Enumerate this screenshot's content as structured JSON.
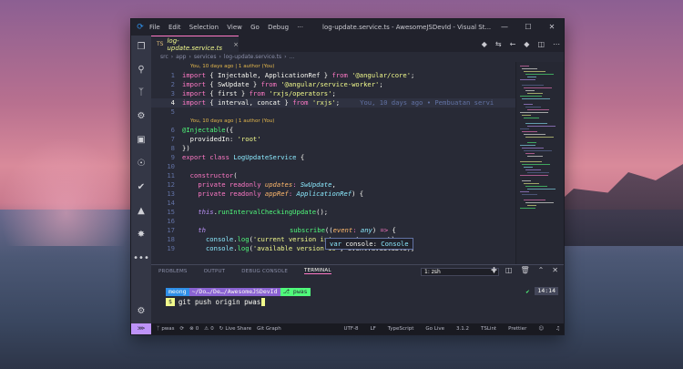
{
  "window": {
    "title": "log-update.service.ts - AwesomeJSDevId - Visual St...",
    "menu": [
      "File",
      "Edit",
      "Selection",
      "View",
      "Go",
      "Debug",
      "···"
    ],
    "controls": {
      "minimize": "—",
      "maximize": "☐",
      "close": "✕"
    }
  },
  "activity_bar": [
    "files-icon",
    "search-icon",
    "source-control-icon",
    "debug-icon",
    "extensions-icon",
    "git-lens-icon",
    "test-icon",
    "remote-icon",
    "settings-sync-icon",
    "more-icon",
    "gear-icon"
  ],
  "tab": {
    "badge": "TS",
    "label": "log-update.service.ts",
    "close": "×"
  },
  "breadcrumb": [
    "src",
    "app",
    "services",
    "log-update.service.ts",
    "..."
  ],
  "editor": {
    "blame_1": "You, 10 days ago | 1 author (You)",
    "blame_2": "You, 10 days ago | 1 author (You)",
    "inline_blame": "You, 10 days ago • Pembuatan servi",
    "line_numbers": [
      "1",
      "2",
      "3",
      "4",
      "5",
      "6",
      "7",
      "8",
      "9",
      "10",
      "11",
      "12",
      "13",
      "14",
      "15",
      "16",
      "17",
      "18",
      "19"
    ],
    "code": {
      "l1": [
        "import",
        " { ",
        "Injectable",
        ", ",
        "ApplicationRef",
        " } ",
        "from",
        " ",
        "'@angular/core'",
        ";"
      ],
      "l2": [
        "import",
        " { ",
        "SwUpdate",
        " } ",
        "from",
        " ",
        "'@angular/service-worker'",
        ";"
      ],
      "l3": [
        "import",
        " { ",
        "first",
        " } ",
        "from",
        " ",
        "'rxjs/operators'",
        ";"
      ],
      "l4": [
        "import",
        " { ",
        "interval",
        ", ",
        "concat",
        " } ",
        "from",
        " ",
        "'rxjs'",
        ";"
      ],
      "l6": [
        "@",
        "Injectable",
        "({"
      ],
      "l7": [
        "  providedIn",
        ": ",
        "'root'"
      ],
      "l8": [
        "})"
      ],
      "l9": [
        "export",
        " ",
        "class",
        " ",
        "LogUpdateService",
        " {"
      ],
      "l11": [
        "  ",
        "constructor",
        "("
      ],
      "l12": [
        "    ",
        "private",
        " ",
        "readonly",
        " ",
        "updates",
        ": ",
        "SwUpdate",
        ","
      ],
      "l13": [
        "    ",
        "private",
        " ",
        "readonly",
        " ",
        "appRef",
        ": ",
        "ApplicationRef",
        ") {"
      ],
      "l15": [
        "    ",
        "this",
        ".",
        "runIntervalCheckingUpdate",
        "();"
      ],
      "l17": [
        "    ",
        "th",
        "",
        "subscribe",
        "((",
        "event",
        ": ",
        "any",
        ") ",
        "=>",
        " {"
      ],
      "l18": [
        "      ",
        "console",
        ".",
        "log",
        "(",
        "'current version is'",
        ", ",
        "event",
        ".",
        "current",
        ");"
      ],
      "l19": [
        "      ",
        "console",
        ".",
        "log",
        "(",
        "'available version is'",
        ", ",
        "event",
        ".",
        "available",
        ");"
      ]
    },
    "tooltip": {
      "keyword": "var",
      "name": "console",
      "type": "Console"
    }
  },
  "panel": {
    "tabs": [
      "PROBLEMS",
      "OUTPUT",
      "DEBUG CONSOLE",
      "TERMINAL"
    ],
    "active_tab": "TERMINAL",
    "terminal_select": "1: zsh",
    "prompt": {
      "user": "meong",
      "path": "~/Do…/De…/AwesomeJSDevId",
      "branch": "⎇ pwas",
      "cmd": "git push origin pwas",
      "symbol": "$",
      "time": "14:14",
      "check": "✔"
    }
  },
  "status_bar": {
    "branch": "pwas",
    "errors": "0",
    "warnings": "0",
    "live_share": "Live Share",
    "git_graph": "Git Graph",
    "encoding": "UTF-8",
    "eol": "LF",
    "language": "TypeScript",
    "go_live": "Go Live",
    "version": "3.1.2",
    "tslint": "TSLint",
    "prettier": "Prettier"
  },
  "colors": {
    "accent": "#ff79c6",
    "editor_bg": "#282a36",
    "status_bg": "#191a21",
    "remote": "#bd93f9"
  }
}
